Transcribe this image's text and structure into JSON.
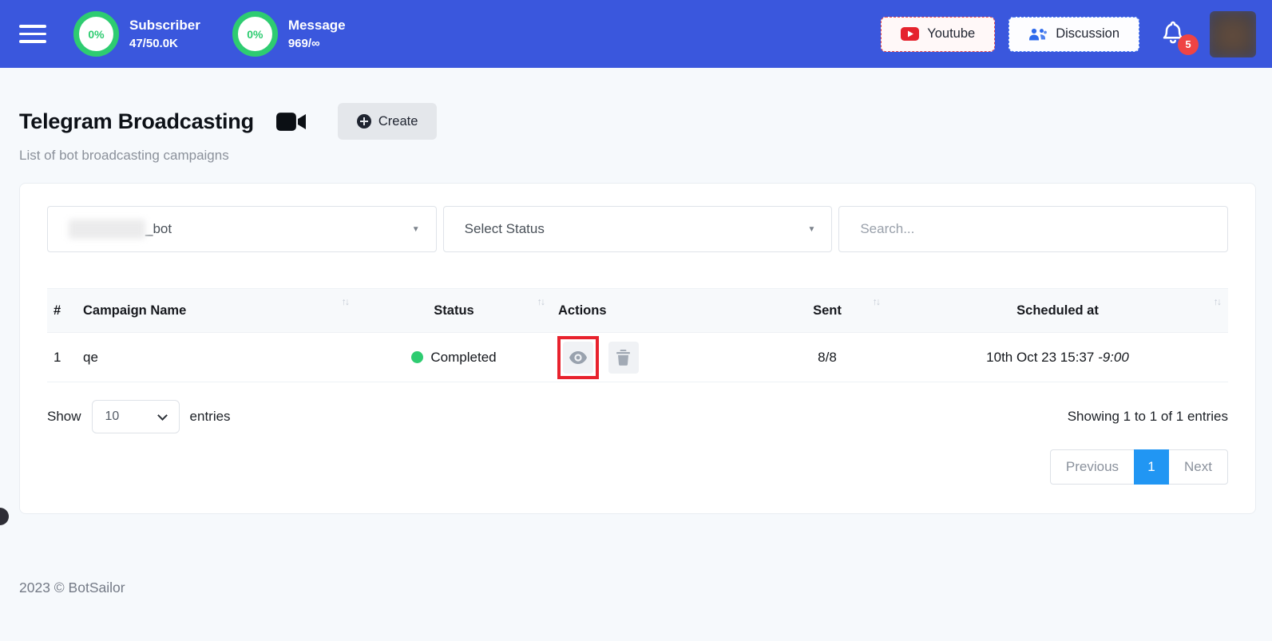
{
  "header": {
    "stats": [
      {
        "percent": "0%",
        "label": "Subscriber",
        "value": "47/50.0K"
      },
      {
        "percent": "0%",
        "label": "Message",
        "value": "969/∞"
      }
    ],
    "youtube_label": "Youtube",
    "discussion_label": "Discussion",
    "notification_count": "5"
  },
  "page": {
    "title": "Telegram Broadcasting",
    "subtitle": "List of bot broadcasting campaigns",
    "create_label": "Create"
  },
  "filters": {
    "bot_select_visible": "_bot",
    "status_placeholder": "Select Status",
    "search_placeholder": "Search..."
  },
  "table": {
    "columns": [
      "#",
      "Campaign Name",
      "Status",
      "Actions",
      "Sent",
      "Scheduled at"
    ],
    "rows": [
      {
        "index": "1",
        "name": "qe",
        "status": "Completed",
        "sent": "8/8",
        "scheduled_date": "10th Oct 23 15:37",
        "scheduled_offset": "-9:00"
      }
    ]
  },
  "footer_controls": {
    "show_label": "Show",
    "page_size": "10",
    "entries_label": "entries",
    "summary": "Showing 1 to 1 of 1 entries",
    "pagination": {
      "previous": "Previous",
      "current": "1",
      "next": "Next"
    }
  },
  "footer": {
    "copyright": "2023 © BotSailor"
  },
  "icons": {
    "sort": "↑↓",
    "caret": "▼"
  },
  "colors": {
    "topbar_blue": "#3a57dd",
    "ring_green": "#2ecc71",
    "status_green": "#2ecc71",
    "notification_red": "#ef4444",
    "youtube_red": "#e5232d",
    "discussion_blue": "#2f6bec",
    "pagination_active_blue": "#2196f3",
    "highlight_red": "#e8222d"
  }
}
